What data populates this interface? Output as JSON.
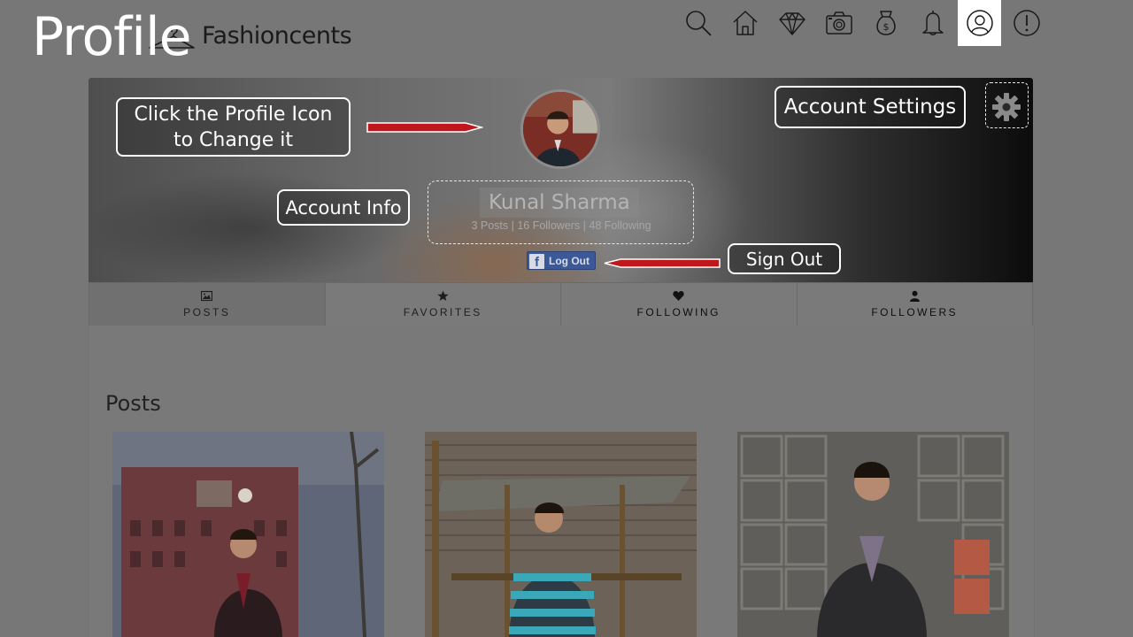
{
  "slide_title": "Profile",
  "brand": {
    "name": "Fashioncents",
    "logo_icon": "hanger-icon"
  },
  "nav": [
    {
      "icon": "search-icon",
      "active": false
    },
    {
      "icon": "home-icon",
      "active": false
    },
    {
      "icon": "diamond-icon",
      "active": false
    },
    {
      "icon": "camera-icon",
      "active": false
    },
    {
      "icon": "money-bag-icon",
      "active": false
    },
    {
      "icon": "bell-icon",
      "active": false
    },
    {
      "icon": "profile-icon",
      "active": true
    },
    {
      "icon": "alert-icon",
      "active": false
    }
  ],
  "profile": {
    "name": "Kunal Sharma",
    "stats": "3 Posts | 16 Followers | 48 Following",
    "logout_label": "Log Out",
    "settings_icon": "gear-icon"
  },
  "annotations": {
    "change_icon": "Click the Profile Icon to Change it",
    "account_info": "Account Info",
    "account_settings": "Account Settings",
    "sign_out": "Sign Out"
  },
  "tabs": [
    {
      "label": "POSTS",
      "icon": "image-icon"
    },
    {
      "label": "FAVORITES",
      "icon": "star-icon"
    },
    {
      "label": "FOLLOWING",
      "icon": "heart-icon"
    },
    {
      "label": "FOLLOWERS",
      "icon": "user-icon"
    }
  ],
  "posts_section": {
    "title": "Posts"
  },
  "colors": {
    "overlay": "#777777",
    "arrow": "#c0171c",
    "facebook": "#3b5998",
    "annotation": "#ffffff"
  }
}
